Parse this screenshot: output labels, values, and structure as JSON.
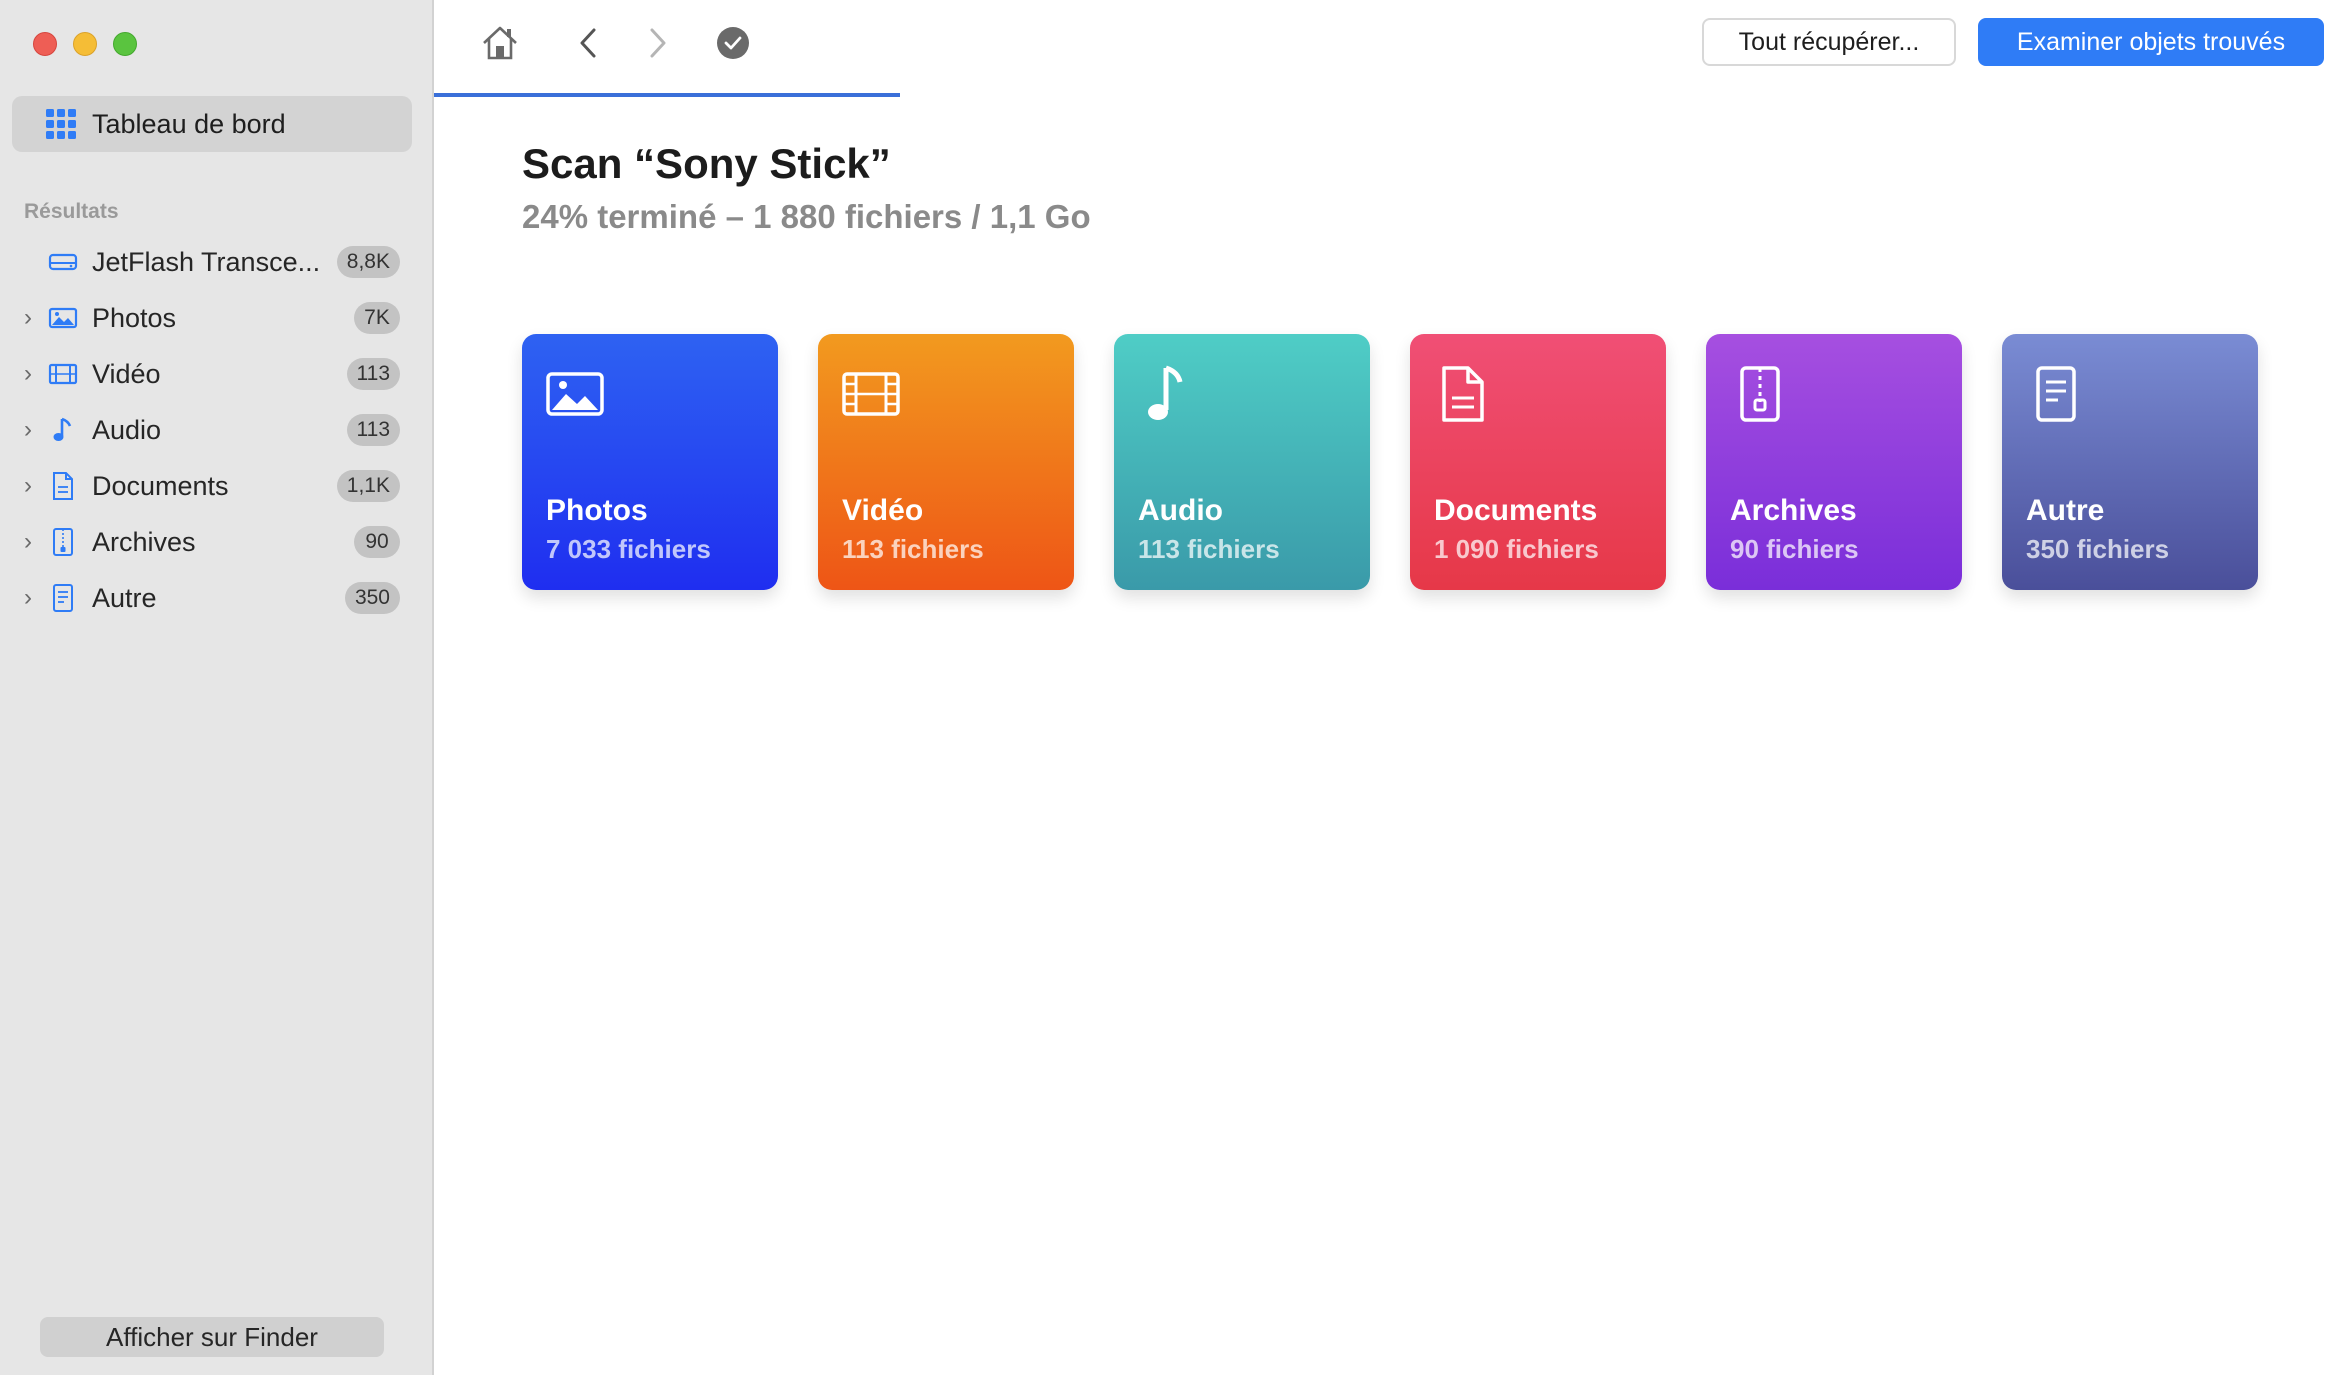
{
  "sidebar": {
    "dashboard_label": "Tableau de bord",
    "section_title": "Résultats",
    "items": [
      {
        "label": "JetFlash Transce...",
        "badge": "8,8K",
        "icon": "drive-icon",
        "expandable": false
      },
      {
        "label": "Photos",
        "badge": "7K",
        "icon": "photo-icon",
        "expandable": true
      },
      {
        "label": "Vidéo",
        "badge": "113",
        "icon": "film-icon",
        "expandable": true
      },
      {
        "label": "Audio",
        "badge": "113",
        "icon": "music-note-icon",
        "expandable": true
      },
      {
        "label": "Documents",
        "badge": "1,1K",
        "icon": "document-icon",
        "expandable": true
      },
      {
        "label": "Archives",
        "badge": "90",
        "icon": "archive-icon",
        "expandable": true
      },
      {
        "label": "Autre",
        "badge": "350",
        "icon": "other-file-icon",
        "expandable": true
      }
    ],
    "finder_button": "Afficher sur Finder"
  },
  "toolbar": {
    "recover_all": "Tout récupérer...",
    "review_found": "Examiner objets trouvés",
    "icons": [
      "home-icon",
      "back-icon",
      "forward-icon",
      "checkmark-icon"
    ],
    "scan_progress": 0.24
  },
  "main": {
    "title": "Scan “Sony Stick”",
    "subtitle": "24% terminé – 1 880 fichiers / 1,1 Go",
    "cards": [
      {
        "name": "Photos",
        "count": "7 033 fichiers",
        "icon": "photo-icon",
        "gradient": [
          "#2e62f2",
          "#1f2ef0"
        ]
      },
      {
        "name": "Vidéo",
        "count": "113 fichiers",
        "icon": "film-icon",
        "gradient": [
          "#f29a1f",
          "#ee5516"
        ]
      },
      {
        "name": "Audio",
        "count": "113 fichiers",
        "icon": "music-note-icon",
        "gradient": [
          "#4fcdc6",
          "#3a9aa9"
        ]
      },
      {
        "name": "Documents",
        "count": "1 090 fichiers",
        "icon": "document-icon",
        "gradient": [
          "#f04f75",
          "#e63848"
        ]
      },
      {
        "name": "Archives",
        "count": "90 fichiers",
        "icon": "archive-icon",
        "gradient": [
          "#a64fe0",
          "#7a2ed9"
        ]
      },
      {
        "name": "Autre",
        "count": "350 fichiers",
        "icon": "other-file-icon",
        "gradient": [
          "#7a8cd4",
          "#4a4f9a"
        ]
      }
    ]
  },
  "colors": {
    "accent": "#2f7cf6",
    "sidebar_icon": "#2f7cf6"
  }
}
